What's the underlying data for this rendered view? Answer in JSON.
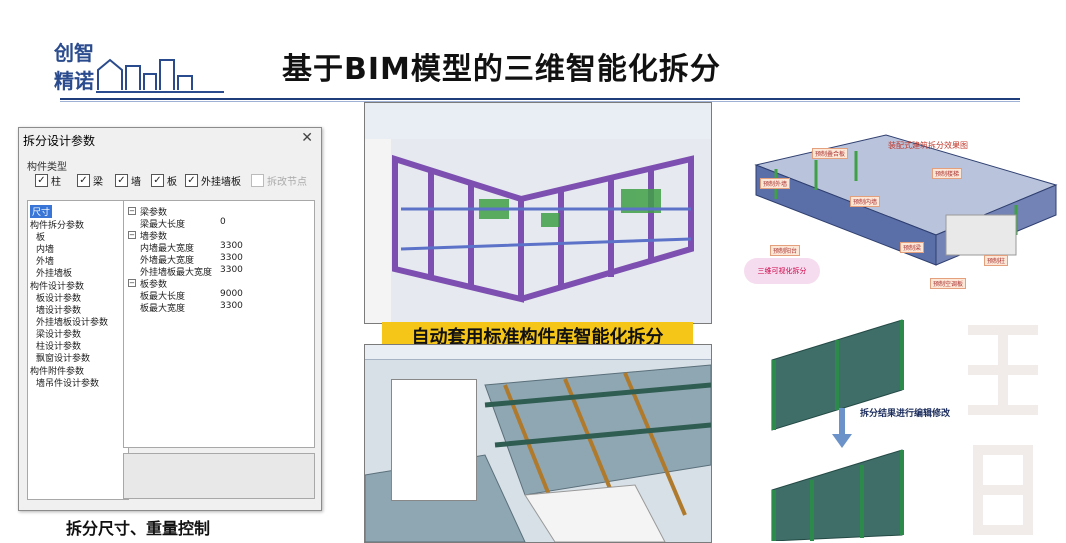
{
  "header": {
    "logo_text": "创智精诺",
    "title": "基于BIM模型的三维智能化拆分"
  },
  "dialog": {
    "title": "拆分设计参数",
    "close_glyph": "✕",
    "group_label": "构件类型",
    "checkboxes": [
      {
        "label": "柱",
        "checked": true
      },
      {
        "label": "梁",
        "checked": true
      },
      {
        "label": "墙",
        "checked": true
      },
      {
        "label": "板",
        "checked": true
      },
      {
        "label": "外挂墙板",
        "checked": true
      },
      {
        "label": "拆改节点",
        "checked": false
      }
    ],
    "tree": [
      {
        "label": "尺寸",
        "indent": 0,
        "selected": true
      },
      {
        "label": "构件拆分参数",
        "indent": 0
      },
      {
        "label": "板",
        "indent": 1
      },
      {
        "label": "内墙",
        "indent": 1
      },
      {
        "label": "外墙",
        "indent": 1
      },
      {
        "label": "外挂墙板",
        "indent": 1
      },
      {
        "label": "构件设计参数",
        "indent": 0
      },
      {
        "label": "板设计参数",
        "indent": 1
      },
      {
        "label": "墙设计参数",
        "indent": 1
      },
      {
        "label": "外挂墙板设计参数",
        "indent": 1
      },
      {
        "label": "梁设计参数",
        "indent": 1
      },
      {
        "label": "柱设计参数",
        "indent": 1
      },
      {
        "label": "飘窗设计参数",
        "indent": 1
      },
      {
        "label": "构件附件参数",
        "indent": 0
      },
      {
        "label": "墙吊件设计参数",
        "indent": 1
      }
    ],
    "properties": [
      {
        "key": "梁参数",
        "group": true
      },
      {
        "key": "梁最大长度",
        "value": "0"
      },
      {
        "key": "墙参数",
        "group": true
      },
      {
        "key": "内墙最大宽度",
        "value": "3300"
      },
      {
        "key": "外墙最大宽度",
        "value": "3300"
      },
      {
        "key": "外挂墙板最大宽度",
        "value": "3300"
      },
      {
        "key": "板参数",
        "group": true
      },
      {
        "key": "板最大长度",
        "value": "9000"
      },
      {
        "key": "板最大宽度",
        "value": "3300"
      }
    ]
  },
  "caption_left": "拆分尺寸、重量控制",
  "banner": "自动套用标准构件库智能化拆分",
  "diagram": {
    "title": "装配式建筑拆分效果图",
    "tags": [
      "预制叠合板",
      "预制楼梯",
      "预制外墙",
      "预制内墙",
      "预制阳台",
      "预制梁",
      "预制柱",
      "预制空调板"
    ],
    "cloud_label": "三维可视化拆分",
    "edit_label": "拆分结果进行编辑修改"
  },
  "colors": {
    "title_rule": "#1e3d7a",
    "banner_bg": "#f5c518",
    "model_purple": "#7d4fb0",
    "model_green": "#3fa046",
    "panel_teal": "#3f6e68"
  }
}
